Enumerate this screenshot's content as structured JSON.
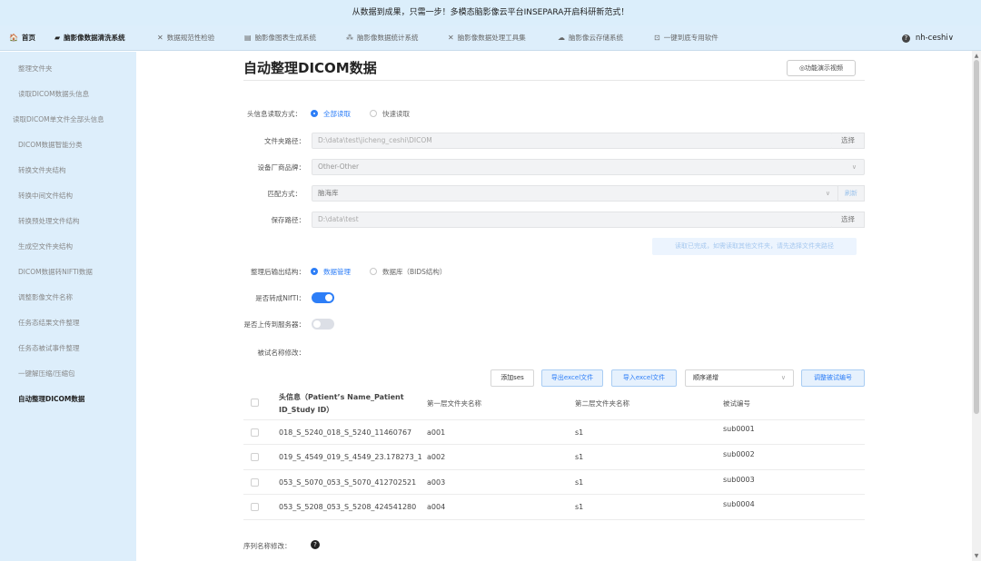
{
  "banner": {
    "text": "从数据到成果，只需一步！多模态脑影像云平台INSEPARA开启科研新范式！"
  },
  "nav": {
    "items": [
      {
        "icon": "home-icon",
        "glyph": "🏠",
        "label": "首页"
      },
      {
        "icon": "folder-icon",
        "glyph": "▰",
        "label": "脑影像数据清洗系统"
      },
      {
        "icon": "tools-icon",
        "glyph": "✕",
        "label": "数据规范性检验"
      },
      {
        "icon": "image-icon",
        "glyph": "▤",
        "label": "脑影像图表生成系统"
      },
      {
        "icon": "stats-icon",
        "glyph": "⁂",
        "label": "脑影像数据统计系统"
      },
      {
        "icon": "tools-icon",
        "glyph": "✕",
        "label": "脑影像数据处理工具集"
      },
      {
        "icon": "cloud-icon",
        "glyph": "☁",
        "label": "脑影像云存储系统"
      },
      {
        "icon": "link-icon",
        "glyph": "⊡",
        "label": "一键到底专用软件"
      }
    ],
    "user": {
      "help": "?",
      "name": "nh-ceshi",
      "caret": "∨"
    }
  },
  "sidebar": {
    "items": [
      "整理文件夹",
      "读取DICOM数据头信息",
      "读取DICOM单文件全部头信息",
      "DICOM数据智能分类",
      "转换文件夹结构",
      "转换中间文件结构",
      "转换预处理文件结构",
      "生成空文件夹结构",
      "DICOM数据转NIFTI数据",
      "调整影像文件名称",
      "任务态结果文件整理",
      "任务态被试事件整理",
      "一键解压缩/压缩包",
      "自动整理DICOM数据"
    ],
    "active_index": 13
  },
  "page": {
    "title": "自动整理DICOM数据",
    "demo_button": "◎功能演示视频"
  },
  "form": {
    "read_mode": {
      "label": "头信息读取方式：",
      "options": [
        "全部读取",
        "快速读取"
      ],
      "selected": 0
    },
    "folder_path": {
      "label": "文件夹路径：",
      "value": "D:\\data\\test\\jicheng_ceshi\\DICOM",
      "button": "选择"
    },
    "vendor": {
      "label": "设备厂商品牌：",
      "value": "Other-Other",
      "caret": "∨"
    },
    "match_mode": {
      "label": "匹配方式：",
      "value": "脑海库",
      "caret": "∨",
      "refresh": "刷新"
    },
    "save_path": {
      "label": "保存路径：",
      "value": "D:\\data\\test",
      "button": "选择"
    },
    "hint_button": "读取已完成，如需读取其他文件夹，请先选择文件夹路径",
    "output_structure": {
      "label": "整理后输出结构：",
      "options": [
        "数据管理",
        "数据库（BIDS结构）"
      ],
      "selected": 0
    },
    "convert_nifti": {
      "label": "是否转成NIfTI：",
      "on": true
    },
    "upload_server": {
      "label": "是否上传到服务器：",
      "on": false
    },
    "subject_rename": {
      "label": "被试名称修改："
    }
  },
  "table_toolbar": {
    "add_ses": "添加ses",
    "export_excel": "导出excel文件",
    "import_excel": "导入excel文件",
    "order_select": "顺序递增",
    "order_caret": "∨",
    "adjust_ids": "调整被试编号"
  },
  "table": {
    "headers": [
      "头信息（Patient’s Name_Patient ID_Study ID）",
      "第一层文件夹名称",
      "第二层文件夹名称",
      "被试编号"
    ],
    "rows": [
      [
        "018_S_5240_018_S_5240_11460767",
        "a001",
        "s1",
        "sub0001"
      ],
      [
        "019_S_4549_019_S_4549_23.178273_1",
        "a002",
        "s1",
        "sub0002"
      ],
      [
        "053_S_5070_053_S_5070_412702521",
        "a003",
        "s1",
        "sub0003"
      ],
      [
        "053_S_5208_053_S_5208_424541280",
        "a004",
        "s1",
        "sub0004"
      ]
    ]
  },
  "series_rename": {
    "label": "序列名称修改：",
    "help": "?"
  }
}
